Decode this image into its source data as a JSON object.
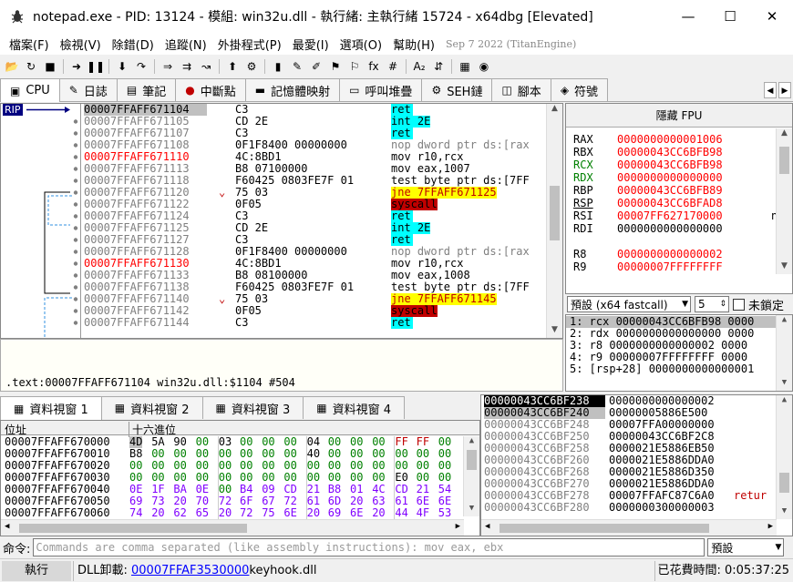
{
  "window": {
    "title": "notepad.exe - PID: 13124 - 模組: win32u.dll - 執行緒: 主執行緒 15724 - x64dbg [Elevated]",
    "minimize": "—",
    "maximize": "☐",
    "close": "✕"
  },
  "menu": {
    "items": [
      "檔案(F)",
      "檢視(V)",
      "除錯(D)",
      "追蹤(N)",
      "外掛程式(P)",
      "最愛(I)",
      "選項(O)",
      "幫助(H)"
    ],
    "version": "Sep 7 2022 (TitanEngine)"
  },
  "toolbar": {
    "icons": [
      "open-icon",
      "restart-icon",
      "stop-icon",
      "sep",
      "run-icon",
      "pause-icon",
      "sep",
      "step-into-icon",
      "step-over-icon",
      "sep",
      "trace-into-icon",
      "trace-over-icon",
      "run-to-user-icon",
      "sep",
      "run-to-return-icon",
      "animate-icon",
      "sep",
      "patch-icon",
      "comment-icon",
      "label-icon",
      "bookmark-icon",
      "function-icon",
      "fx-icon",
      "hash-icon",
      "sep",
      "font-icon",
      "strings-icon",
      "sep",
      "calculator-icon",
      "globe-icon"
    ],
    "glyphs": [
      "📂",
      "↻",
      "■",
      "",
      "➜",
      "❚❚",
      "",
      "⬇",
      "↷",
      "",
      "⇒",
      "⇉",
      "↝",
      "",
      "⬆",
      "⚙",
      "",
      "▮",
      "✎",
      "✐",
      "⚑",
      "⚐",
      "fx",
      "#",
      "",
      "A₂",
      "⇵",
      "",
      "▦",
      "◉"
    ]
  },
  "tabs": [
    {
      "label": "CPU",
      "icon": "▣",
      "active": true
    },
    {
      "label": "日誌",
      "icon": "✎"
    },
    {
      "label": "筆記",
      "icon": "▤"
    },
    {
      "label": "中斷點",
      "icon": "●"
    },
    {
      "label": "記憶體映射",
      "icon": "▬"
    },
    {
      "label": "呼叫堆疊",
      "icon": "▭"
    },
    {
      "label": "SEH鏈",
      "icon": "⚙"
    },
    {
      "label": "腳本",
      "icon": "◫"
    },
    {
      "label": "符號",
      "icon": "◈"
    }
  ],
  "tab_scroll": {
    "left": "◀",
    "right": "▶"
  },
  "rip_label": "RIP",
  "disasm": {
    "rows": [
      {
        "addr": "00007FFAFF671104",
        "bytes": "C3",
        "instr": "ret",
        "cmt": "",
        "sel": true
      },
      {
        "addr": "00007FFAFF671105",
        "bytes": "CD 2E",
        "instr": "int 2E",
        "cmt": ""
      },
      {
        "addr": "00007FFAFF671107",
        "bytes": "C3",
        "instr": "ret",
        "cmt": ""
      },
      {
        "addr": "00007FFAFF671108",
        "bytes": "0F1F8400 00000000",
        "instr": "nop dword ptr ds:[rax",
        "cmt": ""
      },
      {
        "addr": "00007FFAFF671110",
        "bytes": "4C:8BD1",
        "instr": "mov r10,rcx",
        "cmt": "",
        "red": true
      },
      {
        "addr": "00007FFAFF671113",
        "bytes": "B8 07100000",
        "instr": "mov eax,1007",
        "cmt": ""
      },
      {
        "addr": "00007FFAFF671118",
        "bytes": "F60425 0803FE7F 01",
        "instr": "test byte ptr ds:[7FF",
        "cmt": ""
      },
      {
        "addr": "00007FFAFF671120",
        "bytes": "75 03",
        "instr": "jne 7FFAFF671125",
        "cmt": ""
      },
      {
        "addr": "00007FFAFF671122",
        "bytes": "0F05",
        "instr": "syscall",
        "cmt": ""
      },
      {
        "addr": "00007FFAFF671124",
        "bytes": "C3",
        "instr": "ret",
        "cmt": ""
      },
      {
        "addr": "00007FFAFF671125",
        "bytes": "CD 2E",
        "instr": "int 2E",
        "cmt": ""
      },
      {
        "addr": "00007FFAFF671127",
        "bytes": "C3",
        "instr": "ret",
        "cmt": ""
      },
      {
        "addr": "00007FFAFF671128",
        "bytes": "0F1F8400 00000000",
        "instr": "nop dword ptr ds:[rax",
        "cmt": ""
      },
      {
        "addr": "00007FFAFF671130",
        "bytes": "4C:8BD1",
        "instr": "mov r10,rcx",
        "cmt": "",
        "red": true
      },
      {
        "addr": "00007FFAFF671133",
        "bytes": "B8 08100000",
        "instr": "mov eax,1008",
        "cmt": ""
      },
      {
        "addr": "00007FFAFF671138",
        "bytes": "F60425 0803FE7F 01",
        "instr": "test byte ptr ds:[7FF",
        "cmt": ""
      },
      {
        "addr": "00007FFAFF671140",
        "bytes": "75 03",
        "instr": "jne 7FFAFF671145",
        "cmt": ""
      },
      {
        "addr": "00007FFAFF671142",
        "bytes": "0F05",
        "instr": "syscall",
        "cmt": ""
      },
      {
        "addr": "00007FFAFF671144",
        "bytes": "C3",
        "instr": "ret",
        "cmt": ""
      }
    ]
  },
  "info_line": ".text:00007FFAFF671104 win32u.dll:$1104 #504",
  "registers": {
    "header": "隱藏 FPU",
    "rows": [
      {
        "name": "RAX",
        "value": "0000000000001006"
      },
      {
        "name": "RBX",
        "value": "00000043CC6BFB98"
      },
      {
        "name": "RCX",
        "value": "00000043CC6BFB98"
      },
      {
        "name": "RDX",
        "value": "0000000000000000"
      },
      {
        "name": "RBP",
        "value": "00000043CC6BFB89"
      },
      {
        "name": "RSP",
        "value": "00000043CC6BFAD8"
      },
      {
        "name": "RSI",
        "value": "00007FF627170000"
      },
      {
        "name": "RDI",
        "value": "0000000000000000"
      },
      {
        "name": "",
        "value": ""
      },
      {
        "name": "R8",
        "value": "0000000000000002"
      },
      {
        "name": "R9",
        "value": "00000007FFFFFFFF"
      }
    ],
    "rsi_tail": "n"
  },
  "callconv": {
    "value": "預設 (x64 fastcall)",
    "count": "5",
    "lock_label": "未鎖定"
  },
  "args": [
    "1: rcx 00000043CC6BFB98 0000",
    "2: rdx 0000000000000000 0000",
    "3: r8 0000000000000002 0000",
    "4: r9 00000007FFFFFFFF 0000",
    "5: [rsp+28] 0000000000000001"
  ],
  "dump": {
    "tabs": [
      "資料視窗 1",
      "資料視窗 2",
      "資料視窗 3",
      "資料視窗 4"
    ],
    "header_addr": "位址",
    "header_hex": "十六進位",
    "rows": [
      {
        "addr": "00007FFAFF670000",
        "bytes": [
          "4D",
          "5A",
          "90",
          "00",
          "03",
          "00",
          "00",
          "00",
          "04",
          "00",
          "00",
          "00",
          "FF",
          "FF",
          "00"
        ]
      },
      {
        "addr": "00007FFAFF670010",
        "bytes": [
          "B8",
          "00",
          "00",
          "00",
          "00",
          "00",
          "00",
          "00",
          "40",
          "00",
          "00",
          "00",
          "00",
          "00",
          "00"
        ]
      },
      {
        "addr": "00007FFAFF670020",
        "bytes": [
          "00",
          "00",
          "00",
          "00",
          "00",
          "00",
          "00",
          "00",
          "00",
          "00",
          "00",
          "00",
          "00",
          "00",
          "00"
        ]
      },
      {
        "addr": "00007FFAFF670030",
        "bytes": [
          "00",
          "00",
          "00",
          "00",
          "00",
          "00",
          "00",
          "00",
          "00",
          "00",
          "00",
          "00",
          "E0",
          "00",
          "00"
        ]
      },
      {
        "addr": "00007FFAFF670040",
        "bytes": [
          "0E",
          "1F",
          "BA",
          "0E",
          "00",
          "B4",
          "09",
          "CD",
          "21",
          "B8",
          "01",
          "4C",
          "CD",
          "21",
          "54"
        ]
      },
      {
        "addr": "00007FFAFF670050",
        "bytes": [
          "69",
          "73",
          "20",
          "70",
          "72",
          "6F",
          "67",
          "72",
          "61",
          "6D",
          "20",
          "63",
          "61",
          "6E",
          "6E"
        ]
      },
      {
        "addr": "00007FFAFF670060",
        "bytes": [
          "74",
          "20",
          "62",
          "65",
          "20",
          "72",
          "75",
          "6E",
          "20",
          "69",
          "6E",
          "20",
          "44",
          "4F",
          "53"
        ]
      }
    ]
  },
  "stack": {
    "rows": [
      {
        "addr": "00000043CC6BF238",
        "value": "0000000000000002",
        "cmt": "",
        "sel": true
      },
      {
        "addr": "00000043CC6BF240",
        "value": "00000005886E500",
        "cmt": "",
        "sel2": true
      },
      {
        "addr": "00000043CC6BF248",
        "value": "00007FFA00000000",
        "cmt": ""
      },
      {
        "addr": "00000043CC6BF250",
        "value": "00000043CC6BF2C8",
        "cmt": ""
      },
      {
        "addr": "00000043CC6BF258",
        "value": "0000021E5886EB50",
        "cmt": ""
      },
      {
        "addr": "00000043CC6BF260",
        "value": "0000021E5886DDA0",
        "cmt": ""
      },
      {
        "addr": "00000043CC6BF268",
        "value": "0000021E5886D350",
        "cmt": ""
      },
      {
        "addr": "00000043CC6BF270",
        "value": "0000021E5886DDA0",
        "cmt": ""
      },
      {
        "addr": "00000043CC6BF278",
        "value": "00007FFAFC87C6A0",
        "cmt": "retur"
      },
      {
        "addr": "00000043CC6BF280",
        "value": "0000000300000003",
        "cmt": ""
      }
    ]
  },
  "command": {
    "label": "命令:",
    "placeholder": "Commands are comma separated (like assembly instructions): mov eax, ebx",
    "mode": "預設"
  },
  "status": {
    "state": "執行",
    "message_prefix": "DLL卸載: ",
    "message_link": "00007FFAF3530000",
    "message_suffix": "keyhook.dll",
    "time": "已花費時間: 0:05:37:25"
  },
  "colors": {
    "cyan_bg": "#00ffff",
    "yellow_bg": "#ffff00",
    "red_bg": "#c00000",
    "reg_changed": "#ff0000",
    "hex_purple": "#8000ff",
    "hex_green": "#008000"
  }
}
